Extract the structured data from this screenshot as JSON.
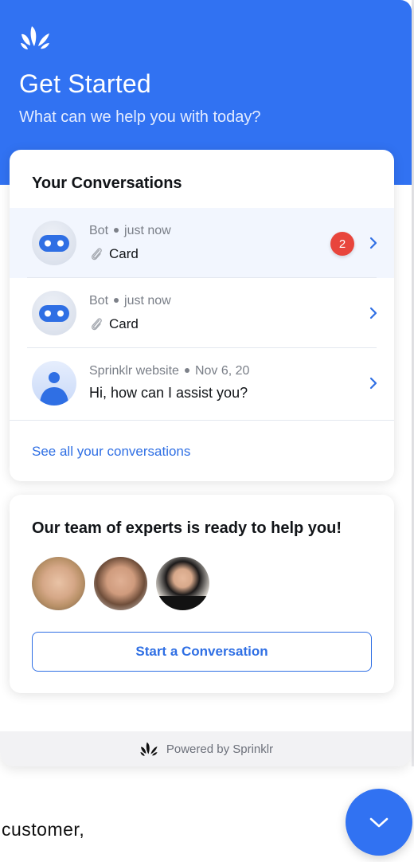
{
  "colors": {
    "brand": "#3172f2",
    "link": "#2f6fe4",
    "badge": "#e8453c",
    "active_row": "#f2f6fe"
  },
  "header": {
    "logo_icon": "sprinklr-logo-icon",
    "title": "Get Started",
    "subtitle": "What can we help you with today?"
  },
  "conversations": {
    "heading": "Your Conversations",
    "items": [
      {
        "sender": "Bot",
        "time": "just now",
        "preview": "Card",
        "preview_icon": "paperclip-icon",
        "avatar": "bot-avatar",
        "unread": "2",
        "active": true
      },
      {
        "sender": "Bot",
        "time": "just now",
        "preview": "Card",
        "preview_icon": "paperclip-icon",
        "avatar": "bot-avatar",
        "unread": null,
        "active": false
      },
      {
        "sender": "Sprinklr website",
        "time": "Nov 6, 20",
        "preview": "Hi, how can I assist you?",
        "preview_icon": null,
        "avatar": "user-avatar",
        "unread": null,
        "active": false
      }
    ],
    "see_all": "See all your conversations"
  },
  "experts": {
    "heading": "Our team of experts is ready to help you!",
    "agents": [
      "agent-photo-1",
      "agent-photo-2",
      "agent-photo-3"
    ],
    "start_button": "Start a Conversation"
  },
  "footer": {
    "powered_by": "Powered by Sprinklr"
  },
  "background_page": {
    "text": "customer,"
  },
  "fab": {
    "icon": "chevron-down-icon"
  }
}
